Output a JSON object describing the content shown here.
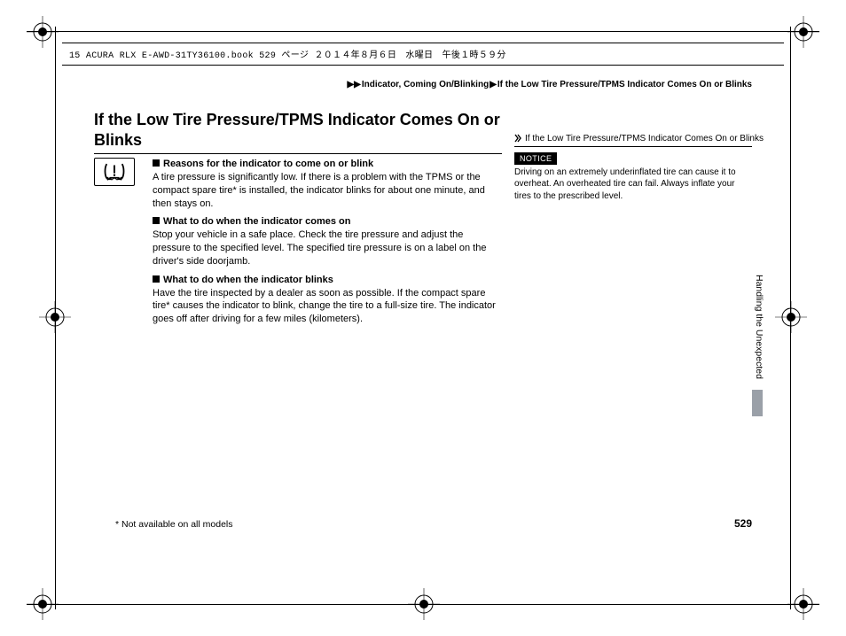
{
  "slug": "15 ACURA RLX E-AWD-31TY36100.book  529 ページ  ２０１４年８月６日　水曜日　午後１時５９分",
  "breadcrumb": {
    "level1": "Indicator, Coming On/Blinking",
    "level2": "If the Low Tire Pressure/TPMS Indicator Comes On or Blinks"
  },
  "title": "If the Low Tire Pressure/TPMS Indicator Comes On or Blinks",
  "sections": [
    {
      "heading": "Reasons for the indicator to come on or blink",
      "body": "A tire pressure is significantly low. If there is a problem with the TPMS or the compact spare tire* is installed, the indicator blinks for about one minute, and then stays on."
    },
    {
      "heading": "What to do when the indicator comes on",
      "body": "Stop your vehicle in a safe place. Check the tire pressure and adjust the pressure to the specified level. The specified tire pressure is on a label on the driver's side doorjamb."
    },
    {
      "heading": "What to do when the indicator blinks",
      "body": "Have the tire inspected by a dealer as soon as possible. If the compact spare tire* causes the indicator to blink, change the tire to a full-size tire. The indicator goes off after driving for a few miles (kilometers)."
    }
  ],
  "side": {
    "title": "If the Low Tire Pressure/TPMS Indicator Comes On or Blinks",
    "notice_label": "NOTICE",
    "notice_body": "Driving on an extremely underinflated tire can cause it to overheat. An overheated tire can fail. Always inflate your tires to the prescribed level."
  },
  "section_tab": "Handling the Unexpected",
  "footnote": "* Not available on all models",
  "page_number": "529"
}
